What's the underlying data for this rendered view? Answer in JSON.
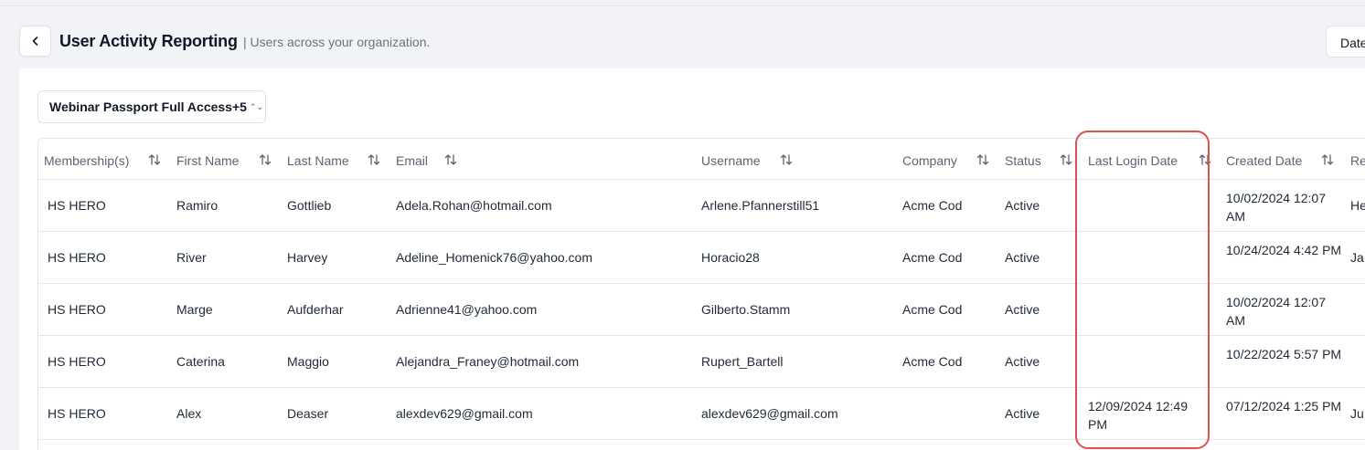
{
  "header": {
    "title": "User Activity Reporting",
    "subtitle": "| Users across your organization.",
    "date_button_label": "Date"
  },
  "filter": {
    "selected": "Webinar Passport Full Access+5"
  },
  "table": {
    "columns": [
      "Membership(s)",
      "First Name",
      "Last Name",
      "Email",
      "Username",
      "Company",
      "Status",
      "Last Login Date",
      "Created Date",
      "Re"
    ],
    "rows": [
      {
        "membership": "HS HERO",
        "first": "Ramiro",
        "last": "Gottlieb",
        "email": "Adela.Rohan@hotmail.com",
        "username": "Arlene.Pfannerstill51",
        "company": "Acme Cod",
        "status": "Active",
        "last_login": "",
        "created": "10/02/2024 12:07 AM",
        "extra": "He"
      },
      {
        "membership": "HS HERO",
        "first": "River",
        "last": "Harvey",
        "email": "Adeline_Homenick76@yahoo.com",
        "username": "Horacio28",
        "company": "Acme Cod",
        "status": "Active",
        "last_login": "",
        "created": "10/24/2024 4:42 PM",
        "extra": "Ja"
      },
      {
        "membership": "HS HERO",
        "first": "Marge",
        "last": "Aufderhar",
        "email": "Adrienne41@yahoo.com",
        "username": "Gilberto.Stamm",
        "company": "Acme Cod",
        "status": "Active",
        "last_login": "",
        "created": "10/02/2024 12:07 AM",
        "extra": ""
      },
      {
        "membership": "HS HERO",
        "first": "Caterina",
        "last": "Maggio",
        "email": "Alejandra_Franey@hotmail.com",
        "username": "Rupert_Bartell",
        "company": "Acme Cod",
        "status": "Active",
        "last_login": "",
        "created": "10/22/2024 5:57 PM",
        "extra": ""
      },
      {
        "membership": "HS HERO",
        "first": "Alex",
        "last": "Deaser",
        "email": "alexdev629@gmail.com",
        "username": "alexdev629@gmail.com",
        "company": "",
        "status": "Active",
        "last_login": "12/09/2024 12:49 PM",
        "created": "07/12/2024 1:25 PM",
        "extra": "Ju"
      }
    ]
  },
  "colors": {
    "highlight": "#d9534f",
    "background": "#f1f3f7"
  }
}
